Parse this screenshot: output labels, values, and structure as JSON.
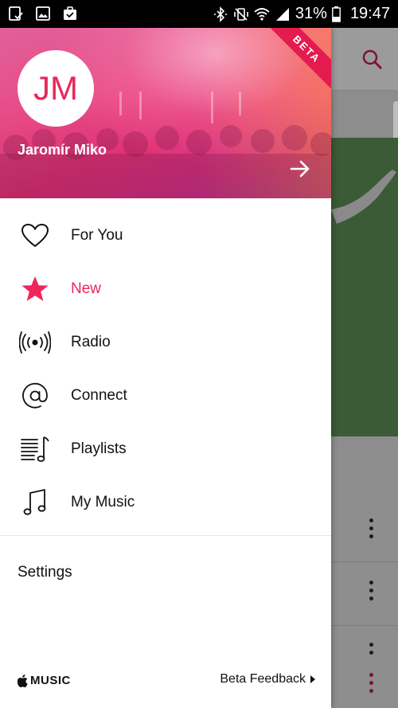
{
  "status_bar": {
    "battery": "31%",
    "time": "19:47",
    "left_icons": [
      "notification-check-icon",
      "image-icon",
      "briefcase-icon"
    ],
    "right_icons": [
      "bluetooth-icon",
      "vibrate-mute-icon",
      "wifi-icon",
      "signal-icon",
      "battery-icon"
    ]
  },
  "drawer": {
    "header": {
      "badge": "BETA",
      "avatar_initials": "JM",
      "user_name": "Jaromír Miko",
      "arrow_icon": "arrow-right-icon"
    },
    "menu": [
      {
        "label": "For You",
        "icon": "heart-icon",
        "active": false
      },
      {
        "label": "New",
        "icon": "star-icon",
        "active": true
      },
      {
        "label": "Radio",
        "icon": "radio-broadcast-icon",
        "active": false
      },
      {
        "label": "Connect",
        "icon": "at-sign-icon",
        "active": false
      },
      {
        "label": "Playlists",
        "icon": "playlist-icon",
        "active": false
      },
      {
        "label": "My Music",
        "icon": "music-note-icon",
        "active": false
      }
    ],
    "settings_label": "Settings",
    "footer": {
      "brand": "MUSIC",
      "feedback_label": "Beta Feedback"
    }
  },
  "colors": {
    "accent": "#f0255a",
    "header_pink": "#e8347a",
    "header_purple": "#b03bb0"
  }
}
